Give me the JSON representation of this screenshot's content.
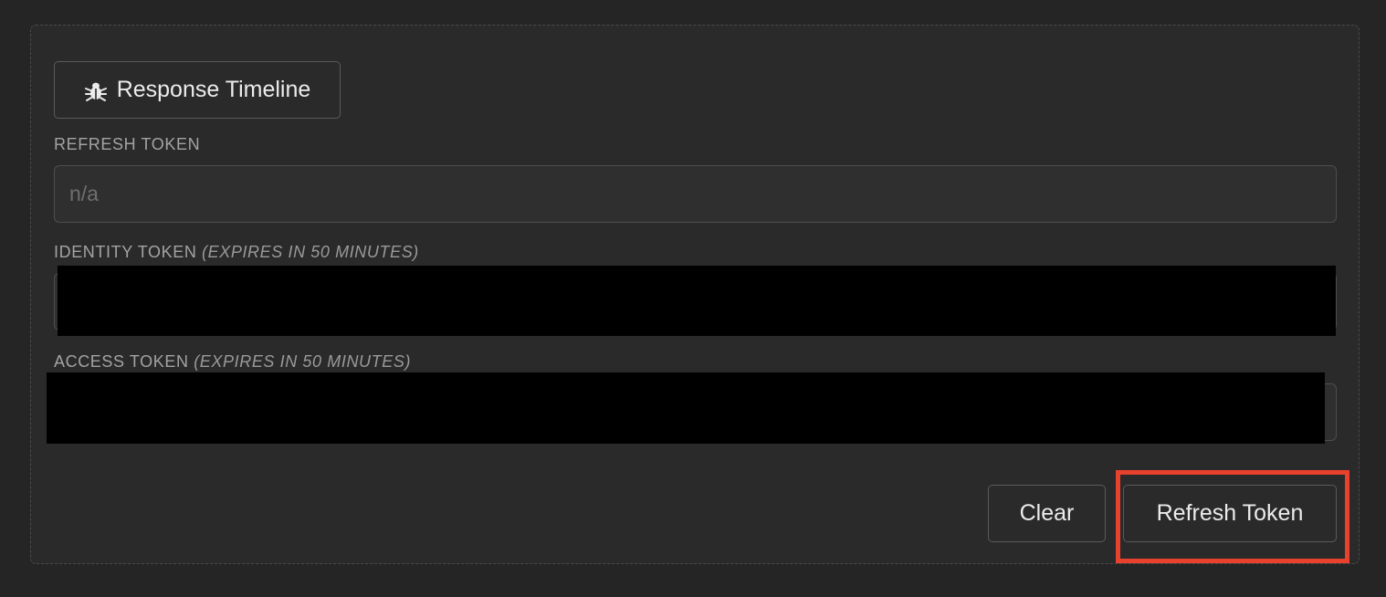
{
  "timeline_button": {
    "label": "Response Timeline",
    "icon": "bug-icon"
  },
  "refresh_token": {
    "label": "REFRESH TOKEN",
    "placeholder": "n/a"
  },
  "identity_token": {
    "label": "IDENTITY TOKEN",
    "note": "(EXPIRES IN 50 MINUTES)"
  },
  "access_token": {
    "label": "ACCESS TOKEN",
    "note": "(EXPIRES IN 50 MINUTES)"
  },
  "actions": {
    "clear_label": "Clear",
    "refresh_label": "Refresh Token"
  },
  "colors": {
    "highlight": "#e8412d",
    "background": "#252525",
    "panel": "#2a2a2a"
  }
}
